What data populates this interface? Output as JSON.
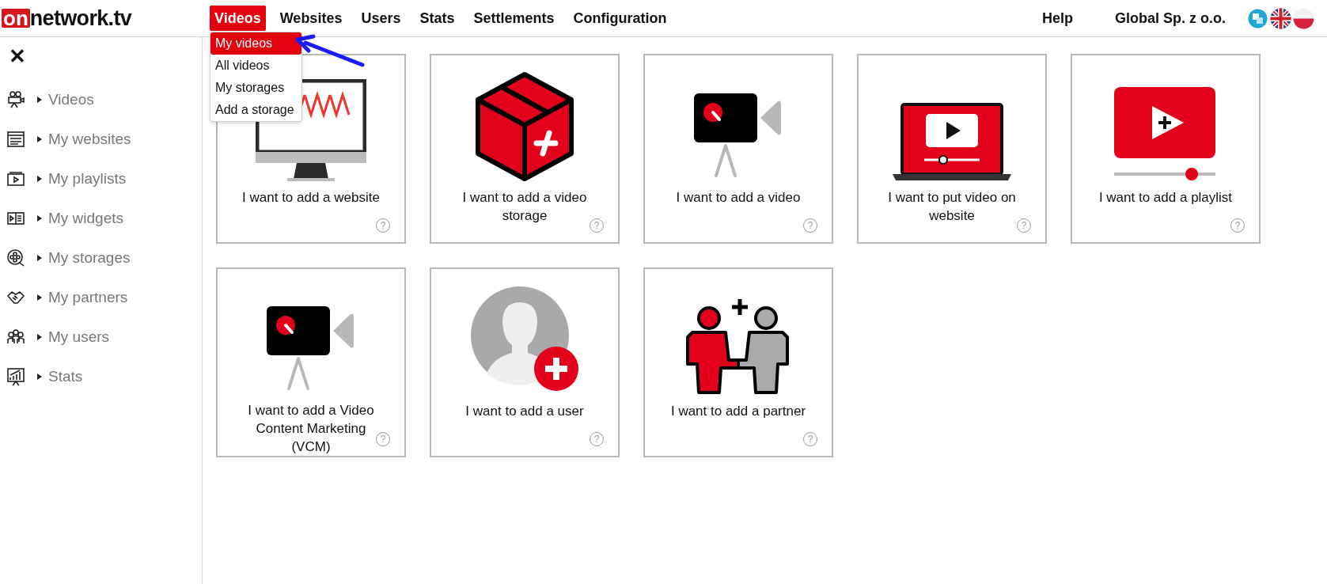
{
  "logo": {
    "badge": "on",
    "text": "network.tv"
  },
  "nav": [
    {
      "label": "Videos",
      "selected": true
    },
    {
      "label": "Websites",
      "selected": false
    },
    {
      "label": "Users",
      "selected": false
    },
    {
      "label": "Stats",
      "selected": false
    },
    {
      "label": "Settlements",
      "selected": false
    },
    {
      "label": "Configuration",
      "selected": false
    }
  ],
  "dropdown": [
    {
      "label": "My videos",
      "selected": true
    },
    {
      "label": "All videos",
      "selected": false
    },
    {
      "label": "My storages",
      "selected": false
    },
    {
      "label": "Add a storage",
      "selected": false
    }
  ],
  "help": "Help",
  "account": "Global Sp. z o.o.",
  "close": "✕",
  "sidebar": {
    "items": [
      {
        "label": "Videos"
      },
      {
        "label": "My websites"
      },
      {
        "label": "My playlists"
      },
      {
        "label": "My widgets"
      },
      {
        "label": "My storages"
      },
      {
        "label": "My partners"
      },
      {
        "label": "My users"
      },
      {
        "label": "Stats"
      }
    ]
  },
  "tiles": [
    {
      "label": "I want to add a website",
      "help": "?"
    },
    {
      "label": "I want to add a video storage",
      "help": "?"
    },
    {
      "label": "I want to add a video",
      "help": "?"
    },
    {
      "label": "I want to put video on website",
      "help": "?"
    },
    {
      "label": "I want to add a playlist",
      "help": "?"
    },
    {
      "label": "I want to add a Video Content Marketing (VCM)",
      "help": "?"
    },
    {
      "label": "I want to add a user",
      "help": "?"
    },
    {
      "label": "I want to add a partner",
      "help": "?"
    }
  ]
}
